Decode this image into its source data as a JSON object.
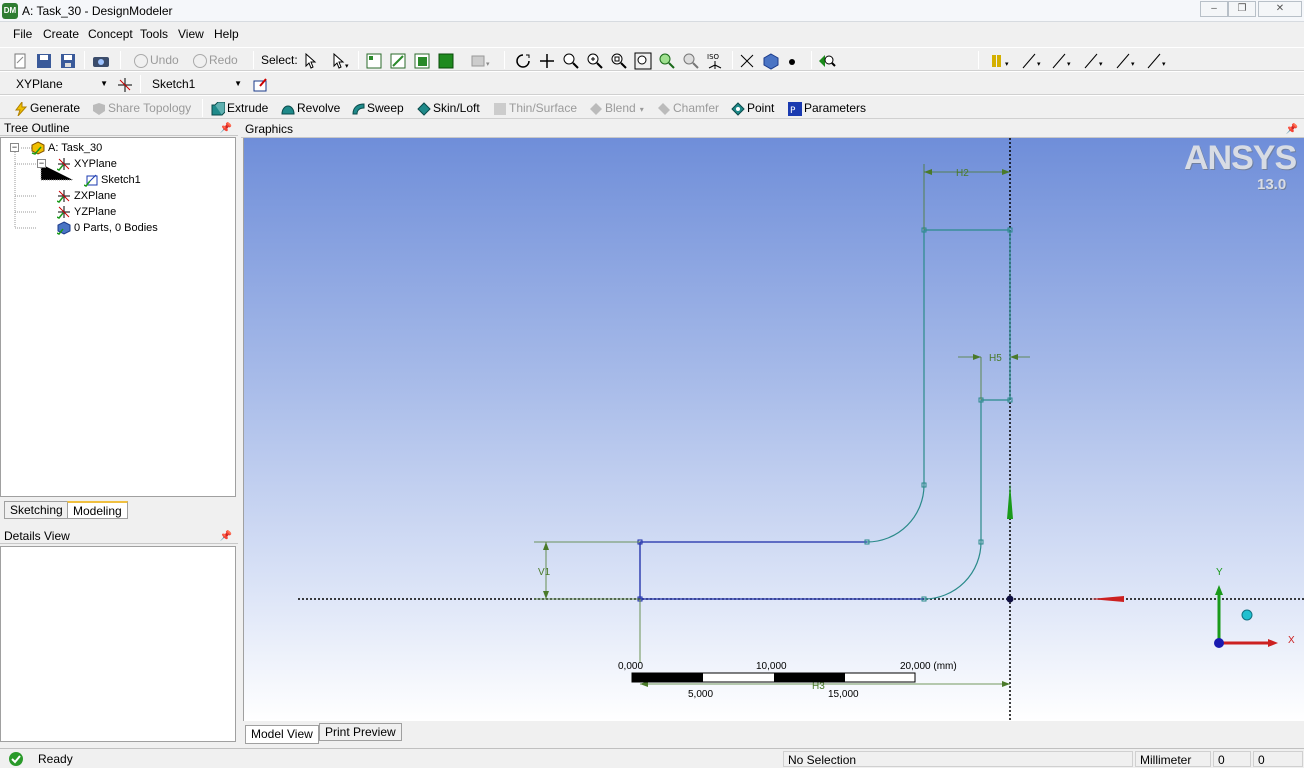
{
  "window": {
    "title": "A: Task_30 - DesignModeler",
    "app_badge": "DM"
  },
  "menu": [
    "File",
    "Create",
    "Concept",
    "Tools",
    "View",
    "Help"
  ],
  "toolbar1": {
    "undo": "Undo",
    "redo": "Redo",
    "select_label": "Select:"
  },
  "toolbar2": {
    "plane": "XYPlane",
    "sketch": "Sketch1"
  },
  "toolbar3": {
    "generate": "Generate",
    "share_topology": "Share Topology",
    "extrude": "Extrude",
    "revolve": "Revolve",
    "sweep": "Sweep",
    "skin_loft": "Skin/Loft",
    "thin_surface": "Thin/Surface",
    "blend": "Blend",
    "chamfer": "Chamfer",
    "point": "Point",
    "parameters": "Parameters"
  },
  "tree": {
    "header": "Tree Outline",
    "items": [
      {
        "label": "A: Task_30",
        "icon": "model-icon"
      },
      {
        "label": "XYPlane",
        "icon": "plane-icon"
      },
      {
        "label": "Sketch1",
        "icon": "sketch-icon"
      },
      {
        "label": "ZXPlane",
        "icon": "plane-icon"
      },
      {
        "label": "YZPlane",
        "icon": "plane-icon"
      },
      {
        "label": "0 Parts, 0 Bodies",
        "icon": "bodies-icon"
      }
    ],
    "tabs": [
      "Sketching",
      "Modeling"
    ],
    "active_tab": "Modeling"
  },
  "details": {
    "header": "Details View"
  },
  "graphics": {
    "header": "Graphics",
    "logo": "ANSYS",
    "version": "13.0",
    "dimensions": {
      "h2": "H2",
      "h5": "H5",
      "v1": "V1",
      "h3": "H3"
    },
    "scale": {
      "top_labels": [
        "0,000",
        "10,000",
        "20,000 (mm)"
      ],
      "bottom_labels": [
        "5,000",
        "15,000"
      ]
    },
    "triad": {
      "x": "X",
      "y": "Y"
    },
    "tabs": [
      "Model View",
      "Print Preview"
    ],
    "active_tab": "Model View"
  },
  "status": {
    "message": "Ready",
    "selection": "No Selection",
    "units": "Millimeter",
    "coord1": "0",
    "coord2": "0"
  },
  "colors": {
    "sketch_line": "#2a8a8a",
    "sketch_selected": "#1a2aa8",
    "dimension": "#4a7a2a",
    "x_axis": "#cc2020",
    "y_axis": "#1a9a1a",
    "z_axis": "#1a1ab0"
  }
}
